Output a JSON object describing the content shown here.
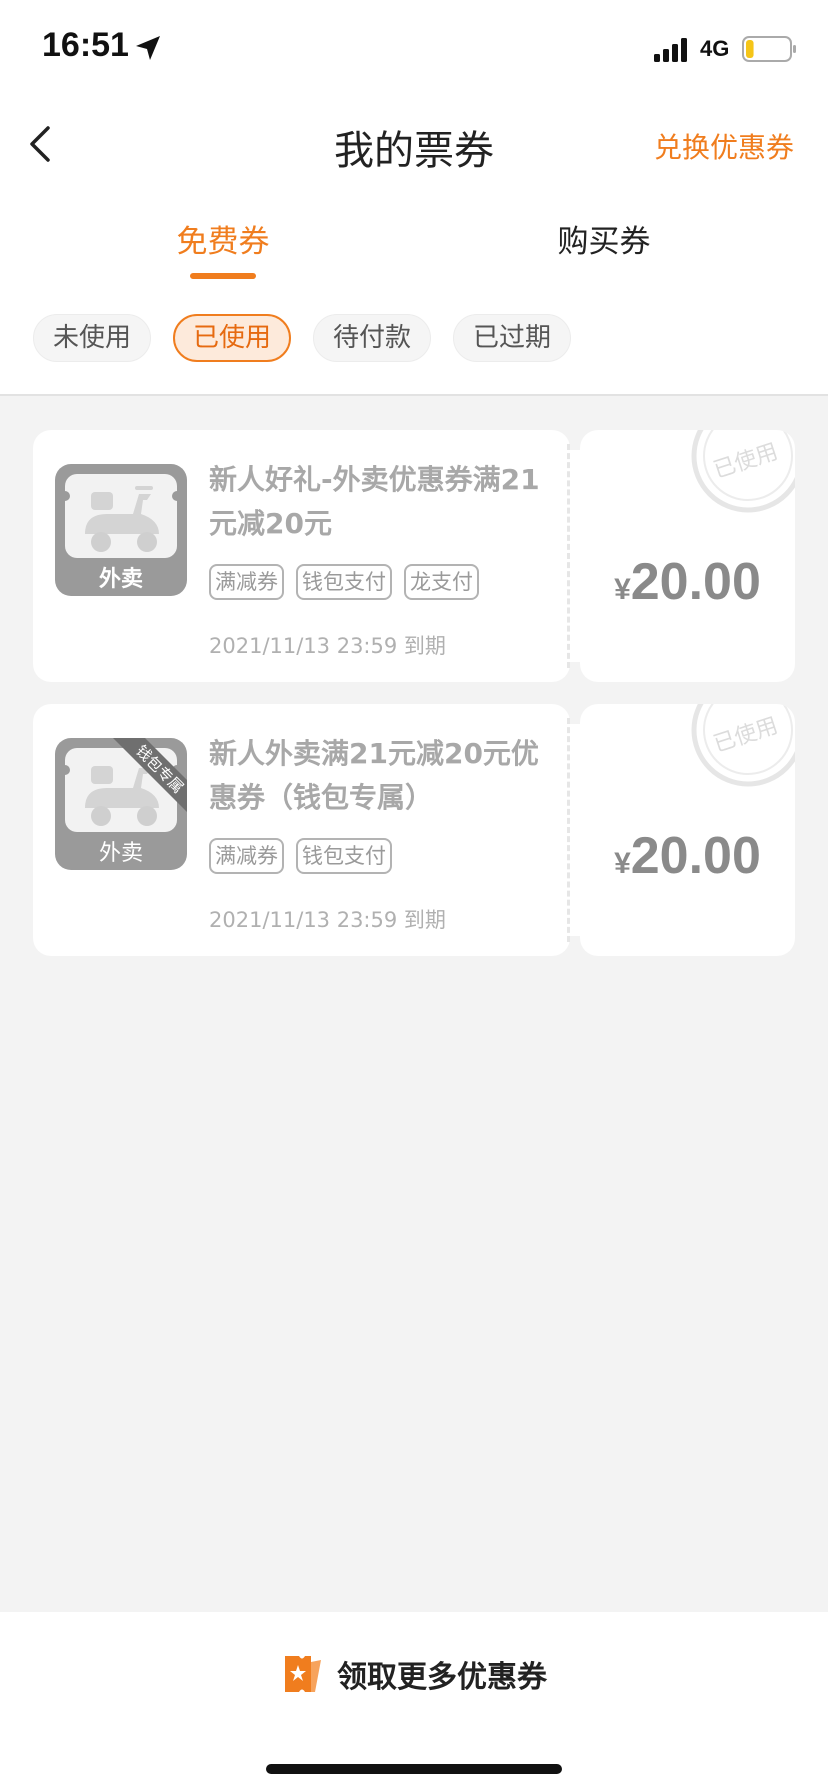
{
  "status_bar": {
    "time": "16:51",
    "network": "4G",
    "battery_level": 0.18
  },
  "nav": {
    "title": "我的票券",
    "action_label": "兑换优惠券",
    "back_icon": "chevron-left-icon"
  },
  "tabs": [
    {
      "label": "免费券",
      "active": true
    },
    {
      "label": "购买券",
      "active": false
    }
  ],
  "filters": [
    {
      "label": "未使用",
      "active": false
    },
    {
      "label": "已使用",
      "active": true
    },
    {
      "label": "待付款",
      "active": false
    },
    {
      "label": "已过期",
      "active": false
    }
  ],
  "coupons": [
    {
      "title": "新人好礼-外卖优惠券满21元减20元",
      "tags": [
        "满减券",
        "钱包支付",
        "龙支付"
      ],
      "expire": "2021/11/13 23:59 到期",
      "currency": "¥",
      "amount": "20.00",
      "thumb_label": "外卖",
      "ribbon": "",
      "stamp": "已使用"
    },
    {
      "title": "新人外卖满21元减20元优惠券（钱包专属）",
      "tags": [
        "满减券",
        "钱包支付"
      ],
      "expire": "2021/11/13 23:59 到期",
      "currency": "¥",
      "amount": "20.00",
      "thumb_label": "外卖",
      "ribbon": "钱包专属",
      "stamp": "已使用"
    }
  ],
  "bottom": {
    "label": "领取更多优惠券",
    "icon": "ticket-icon"
  },
  "colors": {
    "accent": "#f07d1e",
    "background": "#f3f3f3",
    "muted_text": "#a8a8a8"
  }
}
